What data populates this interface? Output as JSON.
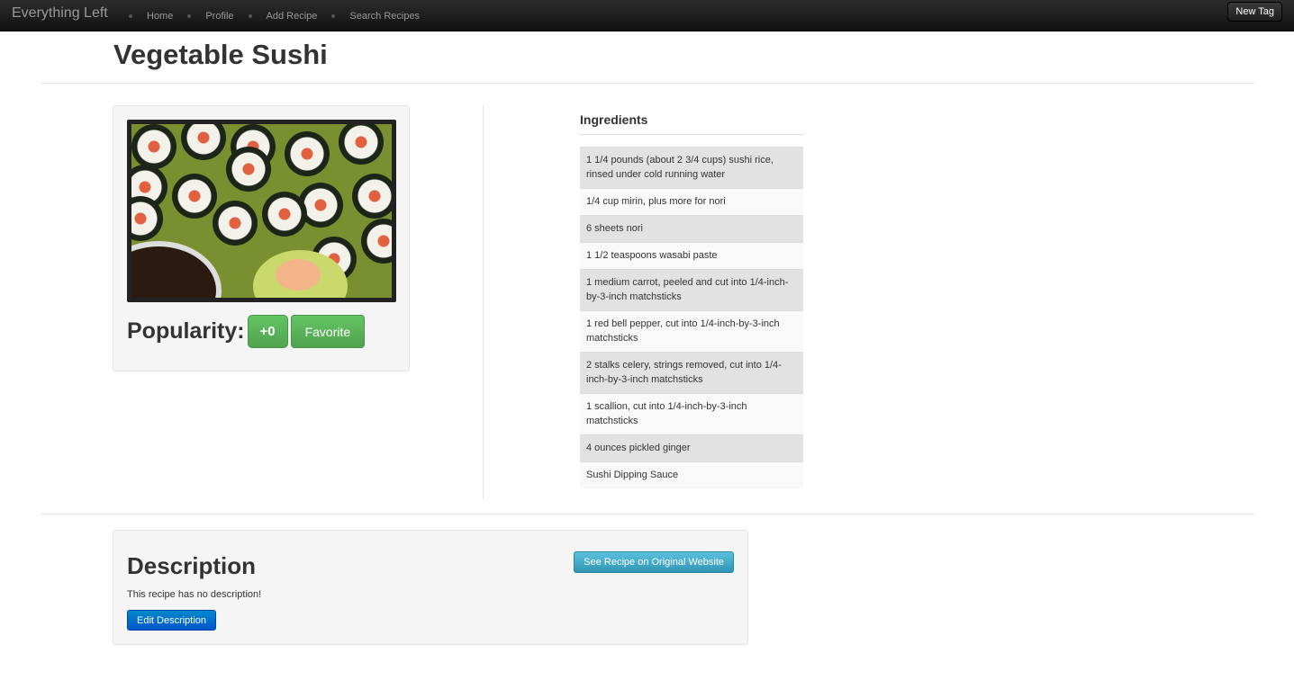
{
  "navbar": {
    "brand": "Everything Left",
    "links": [
      "Home",
      "Profile",
      "Add Recipe",
      "Search Recipes"
    ],
    "new_tag_label": "New Tag"
  },
  "recipe": {
    "title": "Vegetable Sushi",
    "popularity_label": "Popularity:",
    "popularity_count": "+0",
    "favorite_label": "Favorite"
  },
  "ingredients": {
    "heading": "Ingredients",
    "items": [
      "1 1/4 pounds (about 2 3/4 cups) sushi rice, rinsed under cold running water",
      "1/4 cup mirin, plus more for nori",
      "6 sheets nori",
      "1 1/2 teaspoons wasabi paste",
      "1 medium carrot, peeled and cut into 1/4-inch-by-3-inch matchsticks",
      "1 red bell pepper, cut into 1/4-inch-by-3-inch matchsticks",
      "2 stalks celery, strings removed, cut into 1/4-inch-by-3-inch matchsticks",
      "1 scallion, cut into 1/4-inch-by-3-inch matchsticks",
      "4 ounces pickled ginger",
      "Sushi Dipping Sauce"
    ]
  },
  "description": {
    "heading": "Description",
    "text": "This recipe has no description!",
    "edit_label": "Edit Description",
    "original_label": "See Recipe on Original Website"
  }
}
